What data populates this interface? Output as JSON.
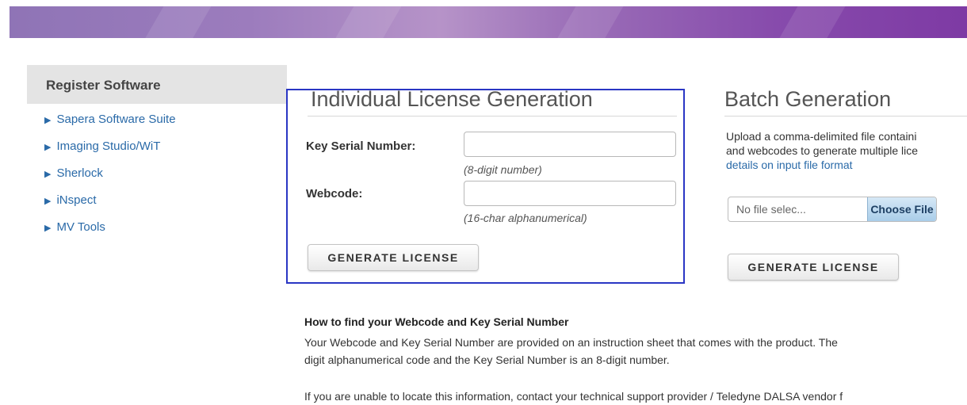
{
  "sidebar": {
    "title": "Register Software",
    "items": [
      {
        "label": "Sapera Software Suite"
      },
      {
        "label": "Imaging Studio/WiT"
      },
      {
        "label": "Sherlock"
      },
      {
        "label": "iNspect"
      },
      {
        "label": "MV Tools"
      }
    ]
  },
  "individual": {
    "title": "Individual License Generation",
    "key_label": "Key Serial Number:",
    "key_hint": "(8-digit number)",
    "webcode_label": "Webcode:",
    "webcode_hint": "(16-char alphanumerical)",
    "generate_label": "GENERATE LICENSE"
  },
  "batch": {
    "title": "Batch Generation",
    "desc_line1": "Upload a comma-delimited file containi",
    "desc_line2": "and webcodes to generate multiple lice",
    "link": "details on input file format",
    "file_status": "No file selec...",
    "choose_label": "Choose File",
    "generate_label": "GENERATE LICENSE"
  },
  "help": {
    "heading": "How to find your Webcode and Key Serial Number",
    "line1": "Your Webcode and Key Serial Number are provided on an instruction sheet that comes with the product. The",
    "line2": "digit alphanumerical code and the Key Serial Number is an 8-digit number.",
    "line3": "If you are unable to locate this information, contact your technical support provider / Teledyne DALSA vendor f"
  },
  "colors": {
    "accent_link": "#2a6aa8",
    "highlight_border": "#2a36c4",
    "banner_purple": "#874bac"
  }
}
